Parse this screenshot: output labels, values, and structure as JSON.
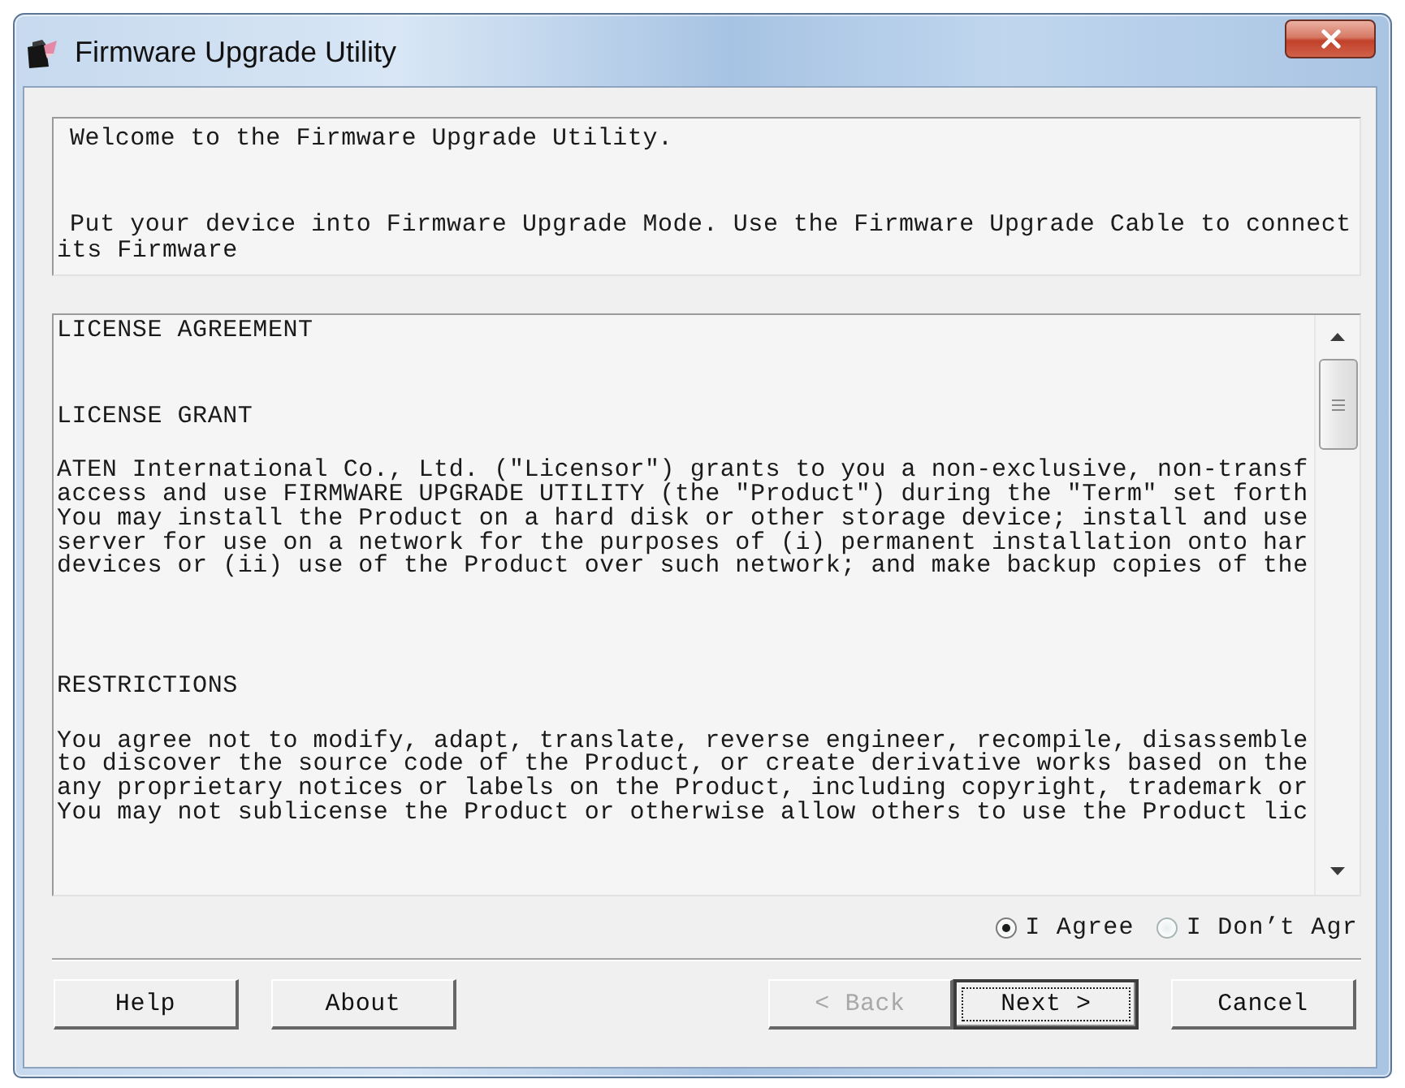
{
  "window": {
    "title": "Firmware Upgrade Utility"
  },
  "welcome": {
    "greeting": "Welcome to the Firmware Upgrade Utility.",
    "instructions": "Put your device into Firmware Upgrade Mode. Use the Firmware Upgrade Cable to connect\nits Firmware"
  },
  "license": {
    "title": "LICENSE AGREEMENT",
    "sections": [
      {
        "heading": "LICENSE GRANT",
        "text": "ATEN International Co., Ltd. (\"Licensor\") grants to you a non-exclusive, non-transf\naccess and use FIRMWARE UPGRADE UTILITY (the \"Product\") during the \"Term\" set forth\nYou may install the Product on a hard disk or other storage device; install and use\nserver for use on a network for the purposes of (i) permanent installation onto har\ndevices or (ii) use of the Product over such network; and make backup copies of the"
      },
      {
        "heading": "RESTRICTIONS",
        "text": "You agree not to modify, adapt, translate, reverse engineer, recompile, disassemble\nto discover the source code of the Product, or create derivative works based on the\nany proprietary notices or labels on the Product, including copyright, trademark or\nYou may not sublicense the Product or otherwise allow others to use the Product lic"
      }
    ]
  },
  "agreement": {
    "options": [
      {
        "label": "I Agree",
        "selected": true
      },
      {
        "label": "I Don’t Agr",
        "selected": false
      }
    ]
  },
  "buttons": {
    "left": [
      {
        "label": "Help",
        "disabled": false,
        "default": false
      },
      {
        "label": "About",
        "disabled": false,
        "default": false
      }
    ],
    "right": [
      {
        "label": "< Back",
        "disabled": true,
        "default": false
      },
      {
        "label": "Next >",
        "disabled": false,
        "default": true
      },
      {
        "label": "Cancel",
        "disabled": false,
        "default": false
      }
    ]
  }
}
